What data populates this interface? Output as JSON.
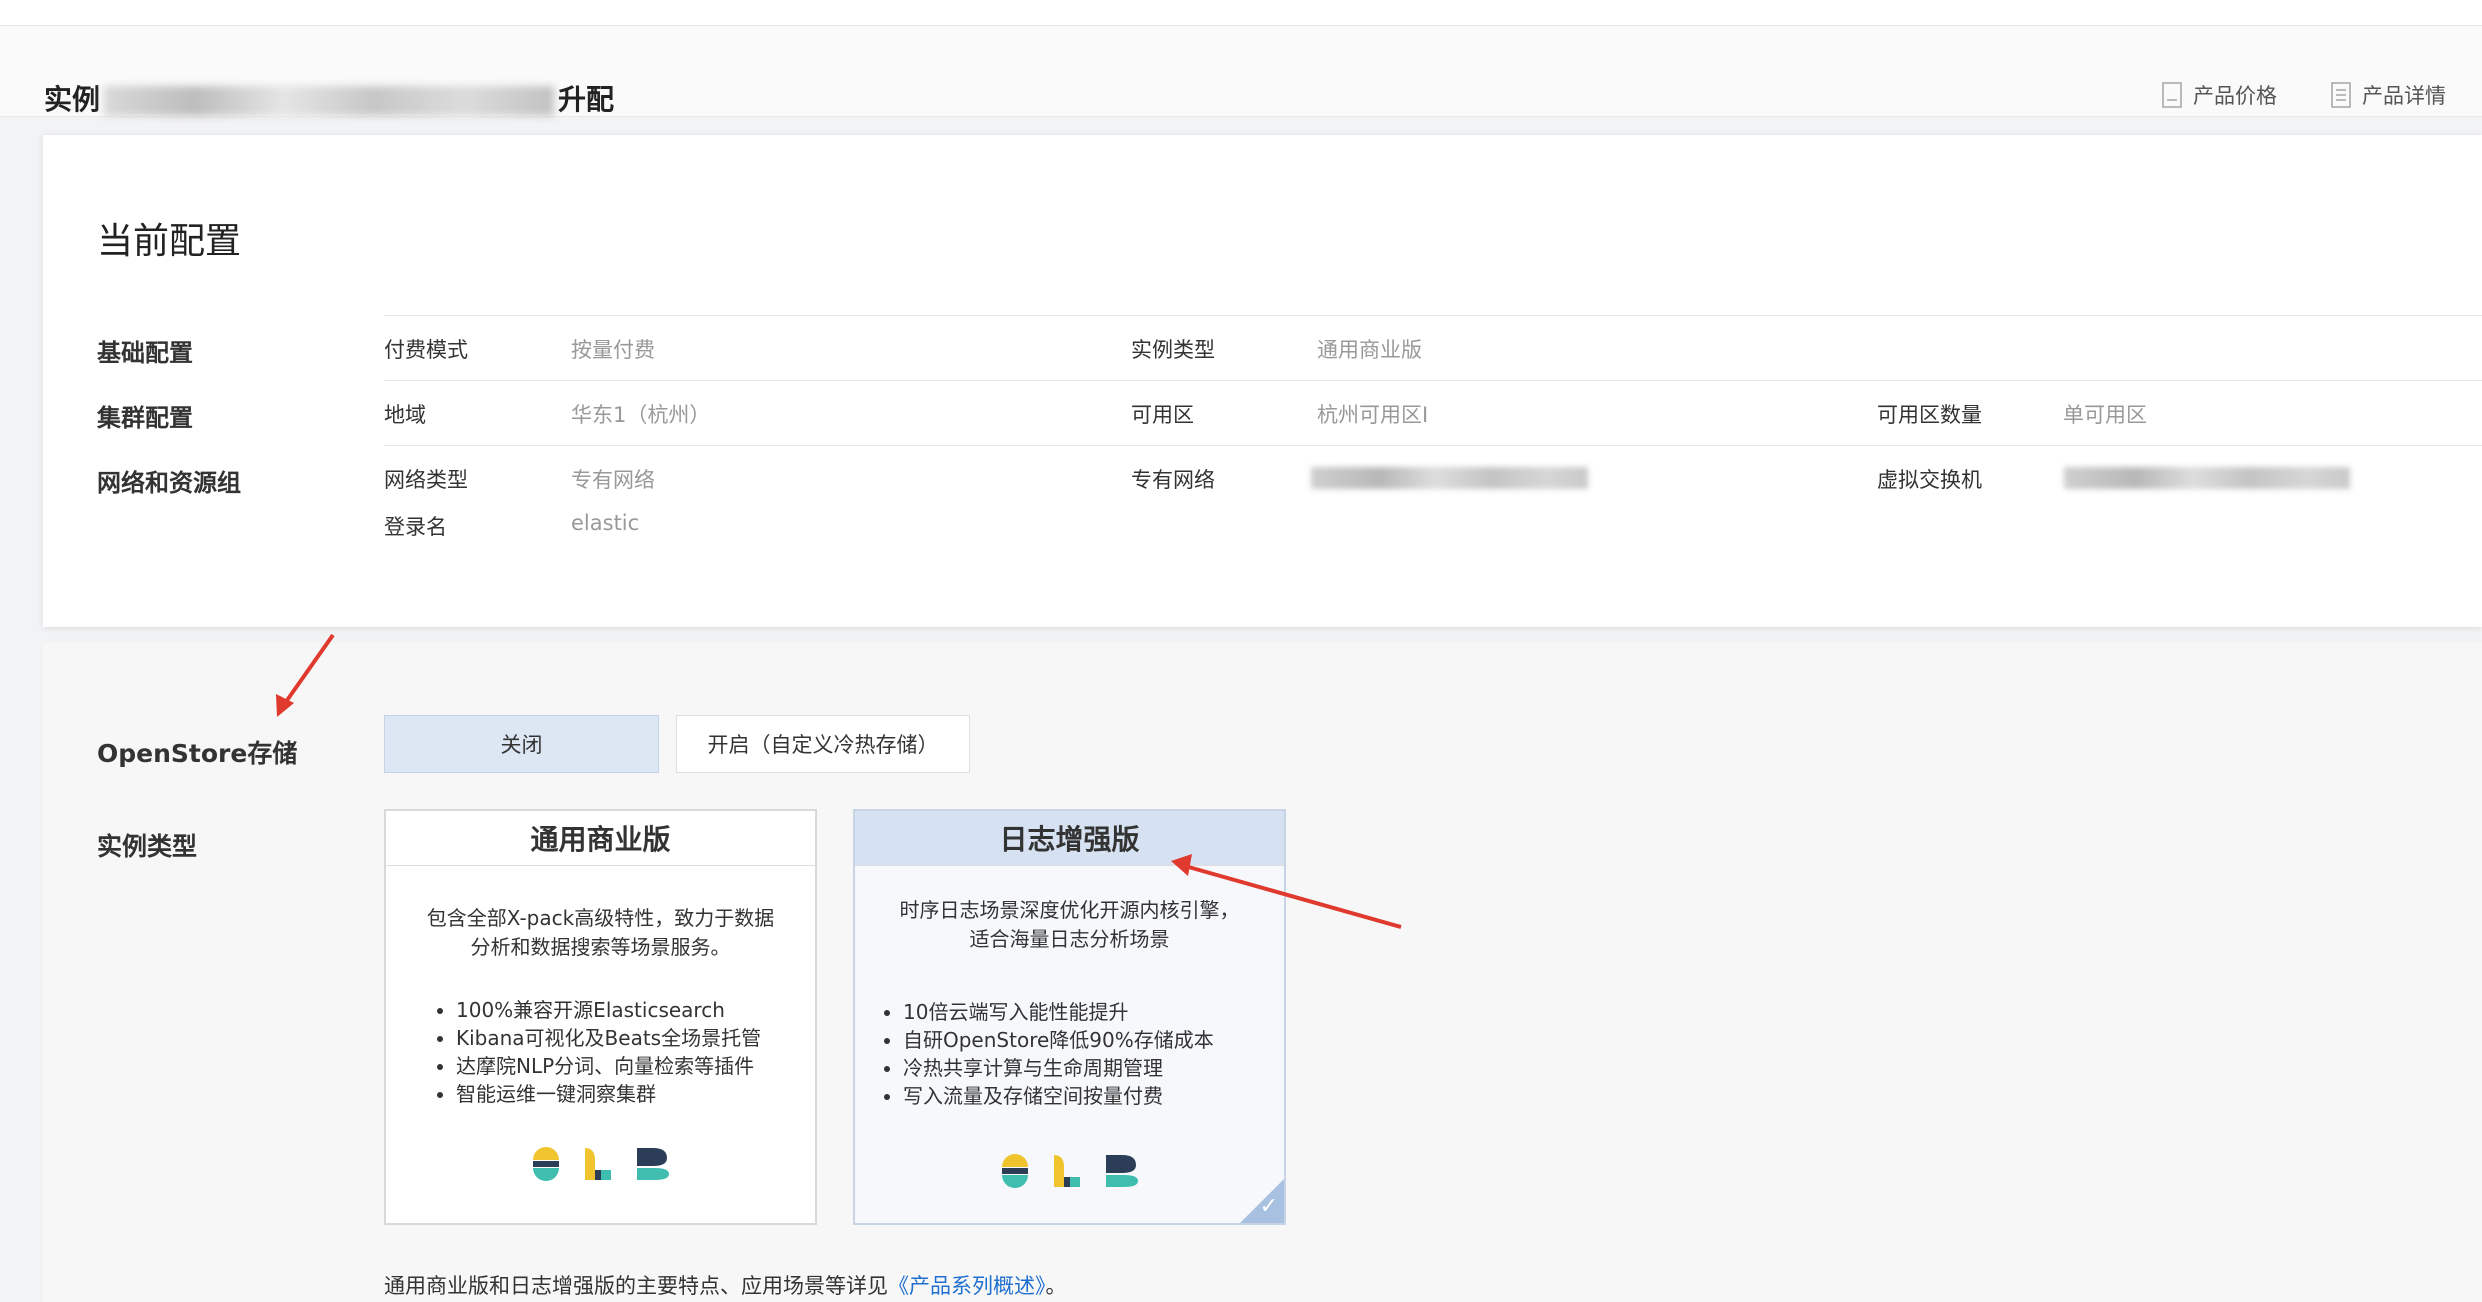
{
  "header": {
    "title_prefix": "实例",
    "title_suffix": "升配",
    "links": [
      {
        "label": "产品价格",
        "icon": "receipt-icon"
      },
      {
        "label": "产品详情",
        "icon": "list-icon"
      }
    ]
  },
  "current_config": {
    "title": "当前配置",
    "rows": [
      {
        "label": "基础配置",
        "items": [
          {
            "key": "付费模式",
            "value": "按量付费"
          },
          {
            "key": "实例类型",
            "value": "通用商业版"
          }
        ]
      },
      {
        "label": "集群配置",
        "items": [
          {
            "key": "地域",
            "value": "华东1（杭州）"
          },
          {
            "key": "可用区",
            "value": "杭州可用区I"
          },
          {
            "key": "可用区数量",
            "value": "单可用区"
          }
        ]
      },
      {
        "label": "网络和资源组",
        "items": [
          {
            "key": "网络类型",
            "value": "专有网络"
          },
          {
            "key": "专有网络",
            "value": ""
          },
          {
            "key": "虚拟交换机",
            "value": ""
          },
          {
            "key": "登录名",
            "value": "elastic"
          }
        ]
      }
    ]
  },
  "openstore": {
    "label": "OpenStore存储",
    "options": [
      "关闭",
      "开启（自定义冷热存储）"
    ],
    "selected": "关闭"
  },
  "instance_type": {
    "label": "实例类型",
    "cards": [
      {
        "title": "通用商业版",
        "desc_line1": "包含全部X-pack高级特性，致力于数据",
        "desc_line2": "分析和数据搜索等场景服务。",
        "features": [
          "100%兼容开源Elasticsearch",
          "Kibana可视化及Beats全场景托管",
          "达摩院NLP分词、向量检索等插件",
          "智能运维一键洞察集群"
        ]
      },
      {
        "title": "日志增强版",
        "desc_line1": "时序日志场景深度优化开源内核引擎，",
        "desc_line2": "适合海量日志分析场景",
        "features": [
          "10倍云端写入能性能提升",
          "自研OpenStore降低90%存储成本",
          "冷热共享计算与生命周期管理",
          "写入流量及存储空间按量付费"
        ]
      }
    ],
    "selected": "日志增强版"
  },
  "footnote": {
    "text": "通用商业版和日志增强版的主要特点、应用场景等详见",
    "link": "《产品系列概述》",
    "end": "。"
  },
  "colors": {
    "selected_bg": "#dde6f3",
    "link": "#1f6fd1",
    "arrow": "#e0392e",
    "elk_yellow": "#f0c42c",
    "elk_teal": "#3fbeb0",
    "elk_navy": "#2b3d57"
  }
}
